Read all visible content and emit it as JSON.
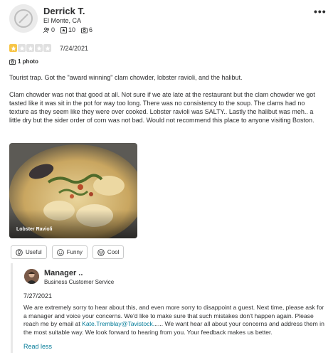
{
  "user": {
    "name": "Derrick T.",
    "location": "El Monte, CA",
    "stats": {
      "friends": "0",
      "reviews": "10",
      "photos": "6"
    }
  },
  "review": {
    "rating": 1,
    "max_rating": 5,
    "date": "7/24/2021",
    "photo_count": "1 photo",
    "paragraphs": [
      "Tourist trap. Got the \"award winning\" clam chowder, lobster ravioli, and the halibut.",
      "Clam chowder was not that good at all. Not sure if we ate late at the restaurant but the clam chowder we got tasted like it was sit in the pot for way too long. There was no consistency to the soup. The clams had no texture as they seem like they were over cooked. Lobster ravioli was SALTY.. Lastly the halibut was meh.. a little dry but the sider order of corn was not bad. Would not recommend this place to anyone visiting Boston."
    ],
    "photo_caption": "Lobster Ravioli"
  },
  "reactions": {
    "useful": "Useful",
    "funny": "Funny",
    "cool": "Cool"
  },
  "owner_reply": {
    "name": "Manager ..",
    "role": "Business Customer Service",
    "date": "7/27/2021",
    "text_before_link": "We are extremely sorry to hear about this, and even more sorry to disappoint a guest. Next time, please ask for a manager and voice your concerns. We'd like to make sure that such mistakes don't happen again. Please reach me by email at ",
    "email": "Kate.Tremblay@Tavistock.",
    "text_after_link": "..... We want hear all about your concerns and address them in the most suitable way. We look forward to hearing from you. Your feedback makes us better.",
    "read_less": "Read less"
  },
  "colors": {
    "star_filled": "#f7c546",
    "star_empty": "#e0e0e0",
    "link": "#027a97",
    "text": "#2d2e2f"
  },
  "icons": {
    "friends": "friends-icon",
    "reviews": "review-star-icon",
    "photos": "camera-icon",
    "more": "more-options-icon",
    "photo_count": "camera-icon",
    "useful": "lightbulb-icon",
    "funny": "smile-icon",
    "cool": "sunglasses-icon"
  }
}
